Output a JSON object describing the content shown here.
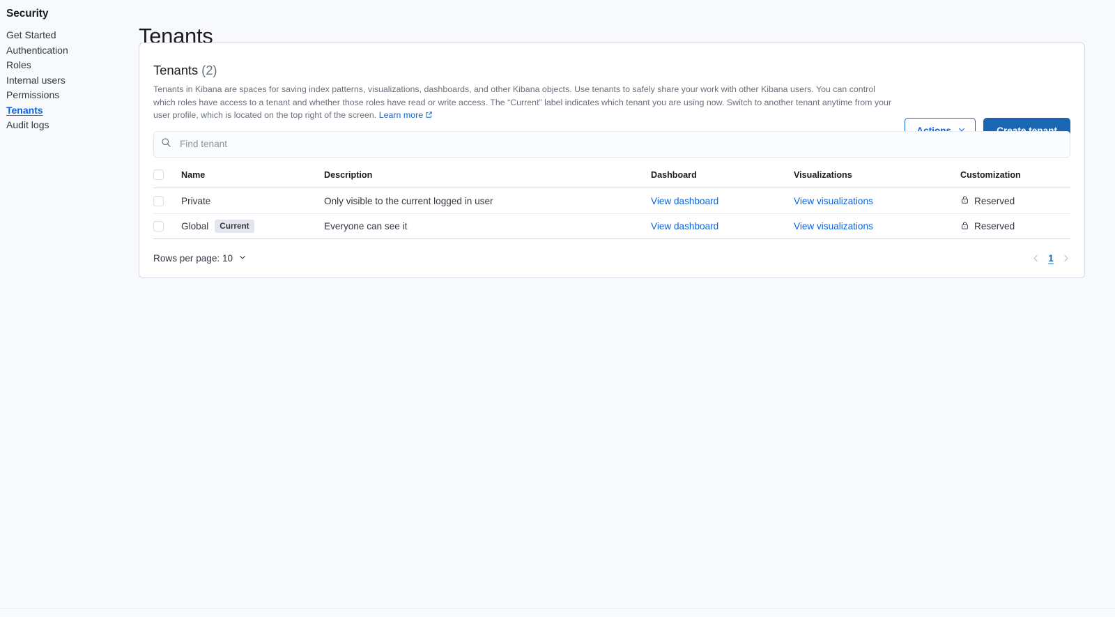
{
  "sidebar": {
    "title": "Security",
    "items": [
      {
        "label": "Get Started",
        "active": false
      },
      {
        "label": "Authentication",
        "active": false
      },
      {
        "label": "Roles",
        "active": false
      },
      {
        "label": "Internal users",
        "active": false
      },
      {
        "label": "Permissions",
        "active": false
      },
      {
        "label": "Tenants",
        "active": true
      },
      {
        "label": "Audit logs",
        "active": false
      }
    ]
  },
  "page": {
    "title": "Tenants"
  },
  "panel": {
    "title": "Tenants",
    "count": "(2)",
    "description": "Tenants in Kibana are spaces for saving index patterns, visualizations, dashboards, and other Kibana objects. Use tenants to safely share your work with other Kibana users. You can control which roles have access to a tenant and whether those roles have read or write access. The “Current” label indicates which tenant you are using now. Switch to another tenant anytime from your user profile, which is located on the top right of the screen. ",
    "learn_more": "Learn more",
    "actions_label": "Actions",
    "create_label": "Create tenant"
  },
  "search": {
    "placeholder": "Find tenant",
    "value": ""
  },
  "table": {
    "columns": [
      "Name",
      "Description",
      "Dashboard",
      "Visualizations",
      "Customization"
    ],
    "rows": [
      {
        "name": "Private",
        "badge": "",
        "description": "Only visible to the current logged in user",
        "dashboard_link": "View dashboard",
        "visualizations_link": "View visualizations",
        "customization": "Reserved"
      },
      {
        "name": "Global",
        "badge": "Current",
        "description": "Everyone can see it",
        "dashboard_link": "View dashboard",
        "visualizations_link": "View visualizations",
        "customization": "Reserved"
      }
    ]
  },
  "footer": {
    "rows_per_page_label": "Rows per page: 10",
    "page_number": "1"
  },
  "colors": {
    "accent": "#0b64dd",
    "primary_button": "#1b66b3",
    "text": "#343741",
    "muted": "#69707d",
    "border": "#d3dae6",
    "badge_bg": "#e4e6ef",
    "page_bg": "#f8f9fc"
  }
}
